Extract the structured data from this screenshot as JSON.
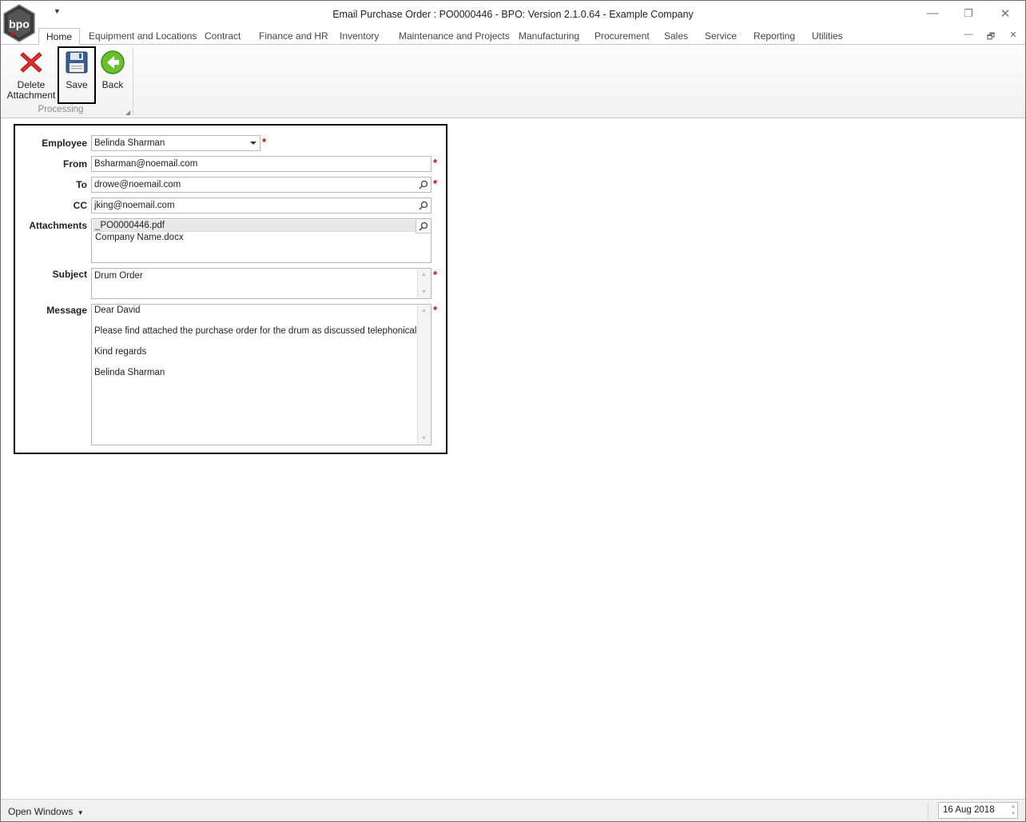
{
  "window": {
    "title": "Email Purchase Order : PO0000446 - BPO: Version 2.1.0.64 - Example Company",
    "logo_text": "bpo",
    "controls": {
      "minimize": "—",
      "restore": "❐",
      "close": "✕"
    },
    "mdi_controls": {
      "minimize": "—",
      "restore": "🗗",
      "close": "✕"
    }
  },
  "ribbon": {
    "tabs": [
      {
        "label": "Home",
        "active": true
      },
      {
        "label": "Equipment and Locations"
      },
      {
        "label": "Contract"
      },
      {
        "label": "Finance and HR"
      },
      {
        "label": "Inventory"
      },
      {
        "label": "Maintenance and Projects"
      },
      {
        "label": "Manufacturing"
      },
      {
        "label": "Procurement"
      },
      {
        "label": "Sales"
      },
      {
        "label": "Service"
      },
      {
        "label": "Reporting"
      },
      {
        "label": "Utilities"
      }
    ],
    "buttons": [
      {
        "label_line1": "Delete",
        "label_line2": "Attachment",
        "icon": "red-x-icon"
      },
      {
        "label": "Save",
        "icon": "floppy-disk-icon"
      },
      {
        "label": "Back",
        "icon": "green-back-arrow-icon"
      }
    ],
    "group_label": "Processing"
  },
  "form": {
    "employee": {
      "label": "Employee",
      "value": "Belinda Sharman"
    },
    "from": {
      "label": "From",
      "value": "Bsharman@noemail.com"
    },
    "to": {
      "label": "To",
      "value": "drowe@noemail.com"
    },
    "cc": {
      "label": "CC",
      "value": "jking@noemail.com"
    },
    "attachments": {
      "label": "Attachments",
      "items": [
        "_PO0000446.pdf",
        "Company Name.docx"
      ]
    },
    "subject": {
      "label": "Subject",
      "value": "Drum Order"
    },
    "message": {
      "label": "Message",
      "lines": [
        "Dear David",
        "Please find attached the purchase order for the drum as discussed telephonically.",
        "Kind regards",
        "Belinda Sharman"
      ]
    },
    "required_marker": "*"
  },
  "statusbar": {
    "open_windows": "Open Windows",
    "date": "16 Aug 2018"
  }
}
